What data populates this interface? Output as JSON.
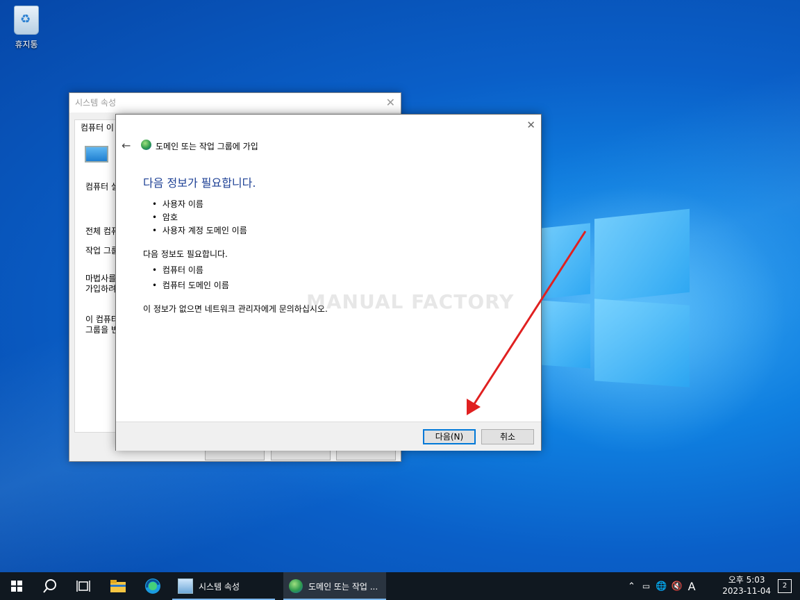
{
  "desktop": {
    "recycle_bin_label": "휴지통",
    "watermark": "MANUAL FACTORY"
  },
  "system_properties": {
    "title": "시스템 속성",
    "tab_label": "컴퓨터 이",
    "line1": "컴퓨터 설",
    "line2": "전체 컴퓨",
    "line3": "작업 그룹",
    "line4a": "마법사를",
    "line4b": "가입하려",
    "line5a": "이 컴퓨터",
    "line5b": "그룹을 변"
  },
  "join_dialog": {
    "title": "도메인 또는 작업 그룹에 가입",
    "heading": "다음 정보가 필요합니다.",
    "required_items": [
      "사용자 이름",
      "암호",
      "사용자 계정 도메인 이름"
    ],
    "also_needed": "다음 정보도 필요합니다.",
    "also_items": [
      "컴퓨터 이름",
      "컴퓨터 도메인 이름"
    ],
    "footer_note": "이 정보가 없으면 네트워크 관리자에게 문의하십시오.",
    "next_button": "다음(N)",
    "cancel_button": "취소"
  },
  "taskbar": {
    "apps": [
      {
        "label": "시스템 속성",
        "icon": "system-properties-icon"
      },
      {
        "label": "도메인 또는 작업 ...",
        "icon": "globe-icon"
      }
    ],
    "ime": "A",
    "clock_line1": "오후 5:03",
    "clock_line2": "2023-11-04",
    "notification_count": "2"
  },
  "colors": {
    "accent": "#0078d7",
    "heading": "#1c3f94",
    "arrow": "#e02020"
  }
}
